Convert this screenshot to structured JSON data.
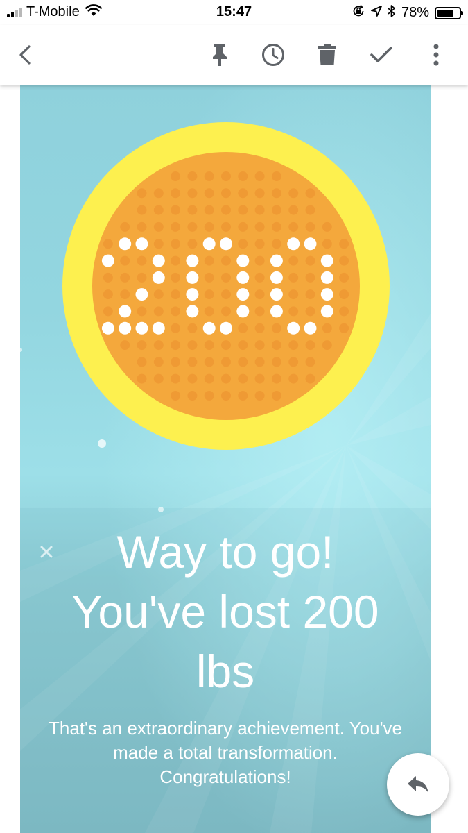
{
  "status_bar": {
    "carrier": "T-Mobile",
    "time": "15:47",
    "battery_percent": "78%",
    "battery_level": 0.78,
    "signal_bars_filled": 2,
    "signal_bars_total": 4
  },
  "toolbar": {
    "back_icon": "chevron-left-icon",
    "pin_icon": "pin-icon",
    "snooze_icon": "clock-icon",
    "delete_icon": "trash-icon",
    "done_icon": "checkmark-icon",
    "more_icon": "more-vert-icon"
  },
  "email": {
    "badge_value": "200",
    "headline_line1": "Way to go!",
    "headline_line2": "You've lost 200",
    "headline_line3": "lbs",
    "body_line1": "That's an extraordinary achievement. You've",
    "body_line2": "made a total transformation.",
    "body_line3": "Congratulations!"
  },
  "reply_icon": "reply-icon",
  "colors": {
    "badge_ring": "#fdf04f",
    "badge_fill": "#f4a83c",
    "badge_dot": "#ef9a34",
    "badge_digit_dot": "#ffffff",
    "background_teal": "#93d6e0",
    "icon_gray": "#5f6368"
  }
}
